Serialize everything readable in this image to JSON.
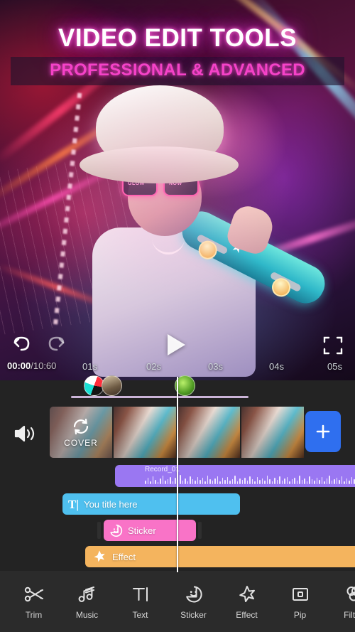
{
  "hero": {
    "title": "VIDEO EDIT TOOLS",
    "subtitle": "PROFESSIONAL & ADVANCED"
  },
  "player": {
    "undo_icon": "undo-icon",
    "redo_icon": "redo-icon",
    "play_icon": "play-icon",
    "fullscreen_icon": "fullscreen-icon",
    "current_time": "00:00",
    "total_time": "/10:60",
    "ruler_ticks": [
      "01s",
      "02s",
      "03s",
      "04s",
      "05s"
    ]
  },
  "timeline": {
    "volume_icon": "volume-icon",
    "cover_label": "COVER",
    "cover_icon": "rotate-icon",
    "add_label": "+",
    "clip_count": 4,
    "tracks": {
      "audio": {
        "name": "Record_01",
        "color": "#9a77f2"
      },
      "text": {
        "label": "You title here",
        "icon": "text-icon",
        "color": "#4fc0ef"
      },
      "sticker": {
        "label": "Sticker",
        "icon": "sticker-icon",
        "color": "#f973c7"
      },
      "effect": {
        "label": "Effect",
        "icon": "effect-star-icon",
        "color": "#f4b45e"
      }
    }
  },
  "toolbar": {
    "items": [
      {
        "label": "Trim",
        "icon": "scissors-icon"
      },
      {
        "label": "Music",
        "icon": "music-note-icon"
      },
      {
        "label": "Text",
        "icon": "text-icon"
      },
      {
        "label": "Sticker",
        "icon": "sticker-smiley-icon"
      },
      {
        "label": "Effect",
        "icon": "effect-star-icon"
      },
      {
        "label": "Pip",
        "icon": "picture-in-picture-icon"
      },
      {
        "label": "Filter",
        "icon": "filter-circles-icon"
      }
    ]
  },
  "colors": {
    "accent_blue": "#2f6fef",
    "neon_pink": "#f542c8",
    "audio_purple": "#9a77f2",
    "text_blue": "#4fc0ef",
    "sticker_pink": "#f973c7",
    "effect_orange": "#f4b45e"
  }
}
